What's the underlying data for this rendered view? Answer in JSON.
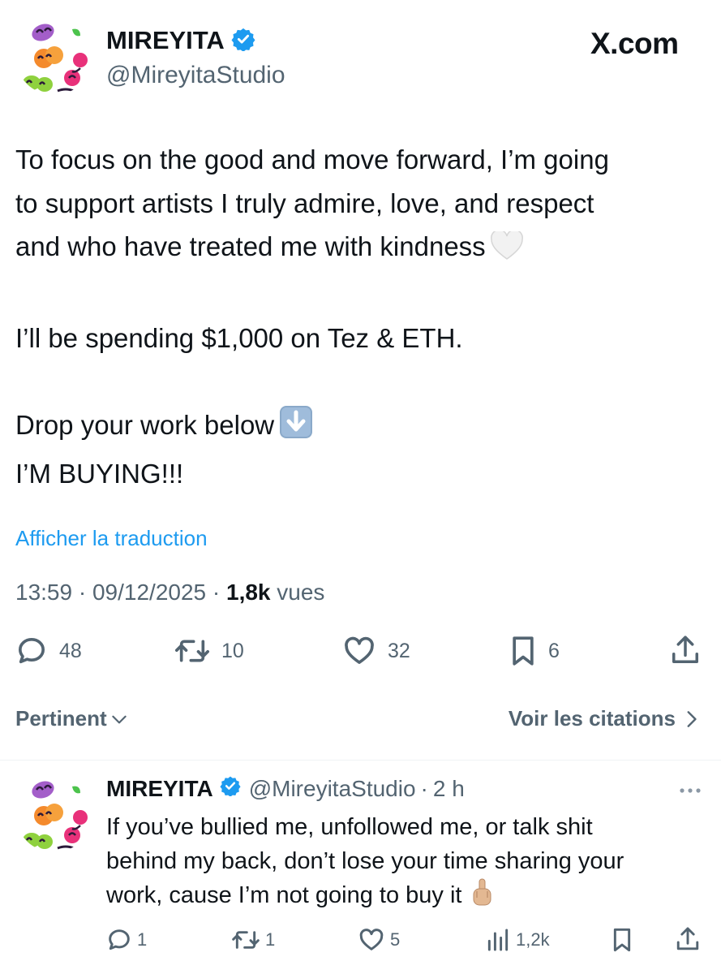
{
  "brand": {
    "label": "X.com"
  },
  "tweet": {
    "author": {
      "display_name": "MIREYITA",
      "handle": "@MireyitaStudio",
      "verified": true
    },
    "text_lines": [
      "To focus on the good and move forward, I’m going",
      "to support artists I truly admire, love, and respect",
      "and who have treated me with kindness",
      "I’ll be spending $1,000 on Tez & ETH.",
      "Drop your work below",
      "I’M BUYING!!!"
    ],
    "translate_link": "Afficher la traduction",
    "time": "13:59",
    "date": "09/12/2025",
    "views_count": "1,8k",
    "views_label": "vues",
    "meta_separator": "·",
    "stats": {
      "replies": "48",
      "reposts": "10",
      "likes": "32",
      "bookmarks": "6"
    }
  },
  "filter": {
    "sort_label": "Pertinent",
    "quotes_label": "Voir les citations"
  },
  "reply": {
    "author": {
      "display_name": "MIREYITA",
      "handle": "@MireyitaStudio",
      "verified": true
    },
    "time_ago": "2 h",
    "separator": "·",
    "text_lines": [
      "If you’ve bullied me, unfollowed me, or talk shit",
      "behind my back, don’t lose your time sharing your",
      "work, cause I’m not going to buy it"
    ],
    "stats": {
      "replies": "1",
      "reposts": "1",
      "likes": "5",
      "views": "1,2k"
    }
  },
  "colors": {
    "accent_blue": "#1d9bf0",
    "text_primary": "#0f1419",
    "text_secondary": "#536471"
  },
  "icons": [
    "verified-badge-icon",
    "reply-icon",
    "repost-icon",
    "like-icon",
    "bookmark-icon",
    "share-icon",
    "views-icon",
    "more-icon",
    "chevron-down-icon",
    "chevron-right-icon",
    "white-heart-emoji-icon",
    "down-arrow-emoji-icon",
    "middle-finger-emoji-icon"
  ]
}
